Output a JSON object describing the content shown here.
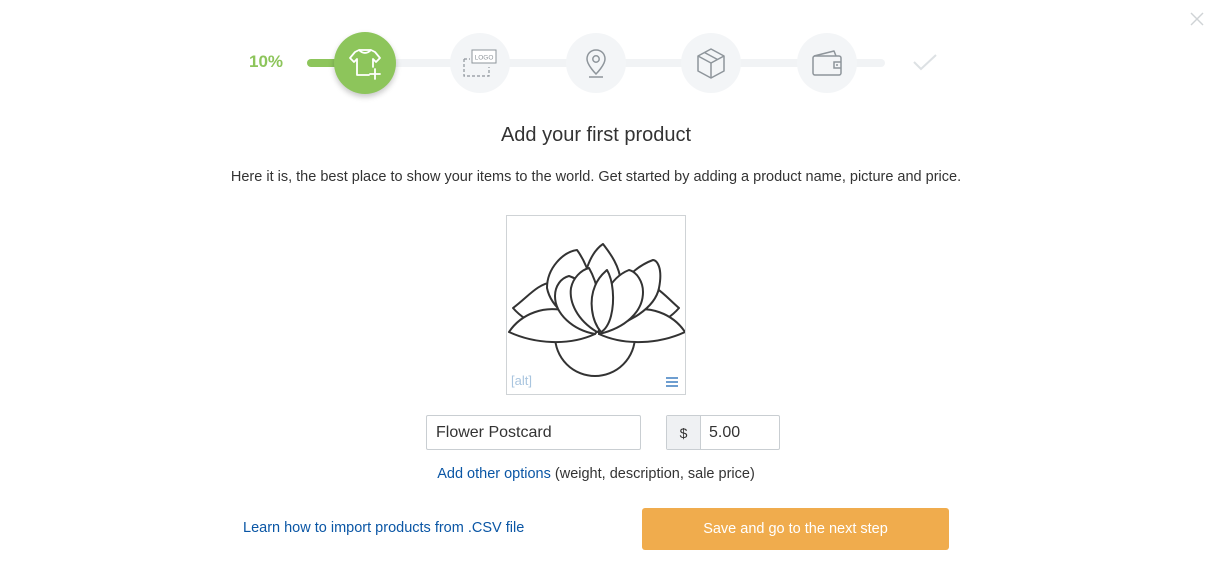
{
  "progress": {
    "percent_label": "10%",
    "percent_value": 0.1,
    "steps": [
      {
        "icon": "tshirt-plus-icon",
        "state": "active"
      },
      {
        "icon": "logo-upload-icon",
        "state": "pending"
      },
      {
        "icon": "location-pin-icon",
        "state": "pending"
      },
      {
        "icon": "box-icon",
        "state": "pending"
      },
      {
        "icon": "wallet-icon",
        "state": "pending"
      },
      {
        "icon": "checkmark-icon",
        "state": "final"
      }
    ],
    "logo_badge_text": "LOGO"
  },
  "colors": {
    "accent_green": "#8dc55b",
    "link_blue": "#0a56a5",
    "button_orange": "#f0ac4d"
  },
  "main": {
    "title": "Add your first product",
    "subtitle": "Here it is, the best place to show your items to the world. Get started by adding a product name, picture and price."
  },
  "product_image": {
    "alt_text": "[alt]",
    "menu_icon": "hamburger-menu-icon",
    "art_icon": "lotus-flower-icon"
  },
  "form": {
    "name_value": "Flower Postcard",
    "currency_symbol": "$",
    "price_value": "5.00"
  },
  "options": {
    "link_label": "Add other options",
    "hint": " (weight, description, sale price)"
  },
  "footer": {
    "csv_link": "Learn how to import products from .CSV file",
    "save_button": "Save and go to the next step"
  }
}
